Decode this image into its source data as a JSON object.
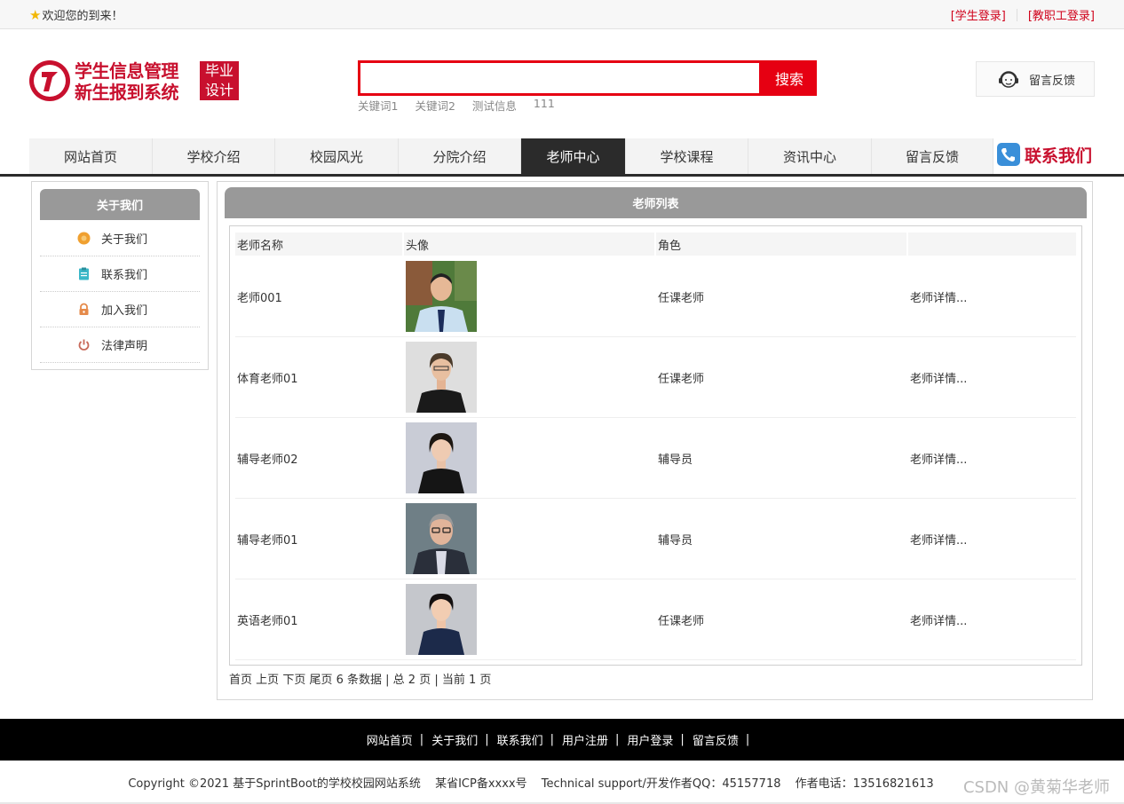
{
  "topbar": {
    "welcome": "欢迎您的到来！",
    "student_login": "[学生登录]",
    "staff_login": "[教职工登录]"
  },
  "logo": {
    "line1": "学生信息管理",
    "line2": "新生报到系统",
    "tag_line1": "毕业",
    "tag_line2": "设计"
  },
  "search": {
    "value": "",
    "button": "搜索",
    "keywords": [
      "关键词1",
      "关键词2",
      "测试信息",
      "111"
    ]
  },
  "feedback": {
    "label": "留言反馈",
    "icon": "customer-service-icon"
  },
  "nav": {
    "items": [
      "网站首页",
      "学校介绍",
      "校园风光",
      "分院介绍",
      "老师中心",
      "学校课程",
      "资讯中心",
      "留言反馈"
    ],
    "active": "老师中心",
    "contact": "联系我们"
  },
  "sidebar": {
    "title": "关于我们",
    "items": [
      {
        "label": "关于我们",
        "icon": "circle-icon",
        "color": "#f0a030"
      },
      {
        "label": "联系我们",
        "icon": "clipboard-icon",
        "color": "#3bb7c8"
      },
      {
        "label": "加入我们",
        "icon": "lock-icon",
        "color": "#e58a4a"
      },
      {
        "label": "法律声明",
        "icon": "power-icon",
        "color": "#c86a5a"
      }
    ]
  },
  "main": {
    "title": "老师列表",
    "columns": [
      "老师名称",
      "头像",
      "角色",
      ""
    ],
    "rows": [
      {
        "name": "老师001",
        "role": "任课老师",
        "detail": "老师详情..."
      },
      {
        "name": "体育老师01",
        "role": "任课老师",
        "detail": "老师详情..."
      },
      {
        "name": "辅导老师02",
        "role": "辅导员",
        "detail": "老师详情..."
      },
      {
        "name": "辅导老师01",
        "role": "辅导员",
        "detail": "老师详情..."
      },
      {
        "name": "英语老师01",
        "role": "任课老师",
        "detail": "老师详情..."
      }
    ],
    "pager": {
      "first": "首页",
      "prev": "上页",
      "next": "下页",
      "last": "尾页",
      "info": "6 条数据 | 总 2 页 | 当前 1 页"
    }
  },
  "footer": {
    "links": [
      "网站首页",
      "关于我们",
      "联系我们",
      "用户注册",
      "用户登录",
      "留言反馈"
    ],
    "copyright": "Copyright ©2021 基于SprintBoot的学校校园网站系统",
    "icp": "某省ICP备xxxx号",
    "support": "Technical support/开发作者QQ：45157718",
    "phone": "作者电话：13516821613",
    "watermark": "CSDN @黄菊华老师"
  },
  "colors": {
    "brand_red": "#c8102e",
    "search_red": "#e60012",
    "nav_active": "#2b2b2b",
    "panel_gray": "#999999"
  }
}
